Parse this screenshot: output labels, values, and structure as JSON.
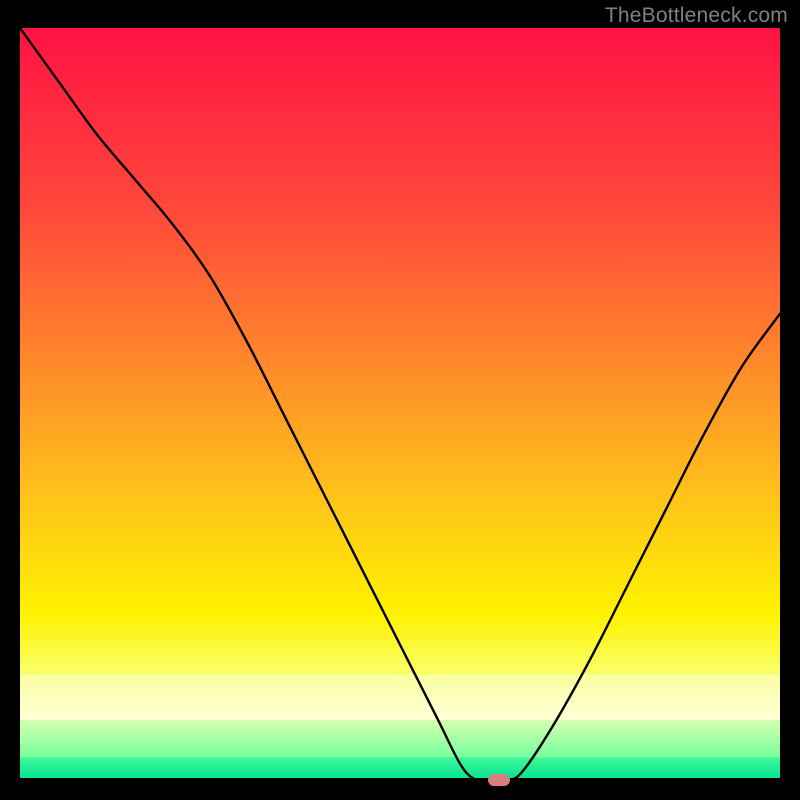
{
  "attribution": "TheBottleneck.com",
  "chart_data": {
    "type": "line",
    "title": "",
    "xlabel": "",
    "ylabel": "",
    "x_range": [
      0,
      100
    ],
    "y_range": [
      0,
      100
    ],
    "series": [
      {
        "name": "bottleneck-curve",
        "x": [
          0,
          5,
          10,
          15,
          20,
          25,
          30,
          35,
          40,
          45,
          50,
          55,
          58,
          60,
          62,
          64,
          66,
          70,
          75,
          80,
          85,
          90,
          95,
          100
        ],
        "y": [
          100,
          93,
          86,
          80,
          74,
          67,
          58,
          48,
          38,
          28,
          18,
          8,
          2,
          0,
          0,
          0,
          1,
          7,
          16,
          26,
          36,
          46,
          55,
          62
        ]
      }
    ],
    "marker": {
      "x": 63,
      "y": 0,
      "color": "#d77f7f"
    },
    "gradient_bands": [
      {
        "colors": [
          "#ff1244",
          "#ff4a3a"
        ],
        "from": 0,
        "to": 25
      },
      {
        "colors": [
          "#ff4a3a",
          "#ff8a2a"
        ],
        "from": 25,
        "to": 45
      },
      {
        "colors": [
          "#ff8a2a",
          "#ffc21a"
        ],
        "from": 45,
        "to": 62
      },
      {
        "colors": [
          "#ffc21a",
          "#fff200"
        ],
        "from": 62,
        "to": 78
      },
      {
        "colors": [
          "#fff200",
          "#f9ff6a"
        ],
        "from": 78,
        "to": 86
      },
      {
        "colors": [
          "#f9ffa0",
          "#ffffd6"
        ],
        "from": 86,
        "to": 92
      },
      {
        "colors": [
          "#d6ffb0",
          "#77ff9c"
        ],
        "from": 92,
        "to": 97
      },
      {
        "colors": [
          "#40f79a",
          "#00e58e"
        ],
        "from": 97,
        "to": 100
      }
    ]
  }
}
